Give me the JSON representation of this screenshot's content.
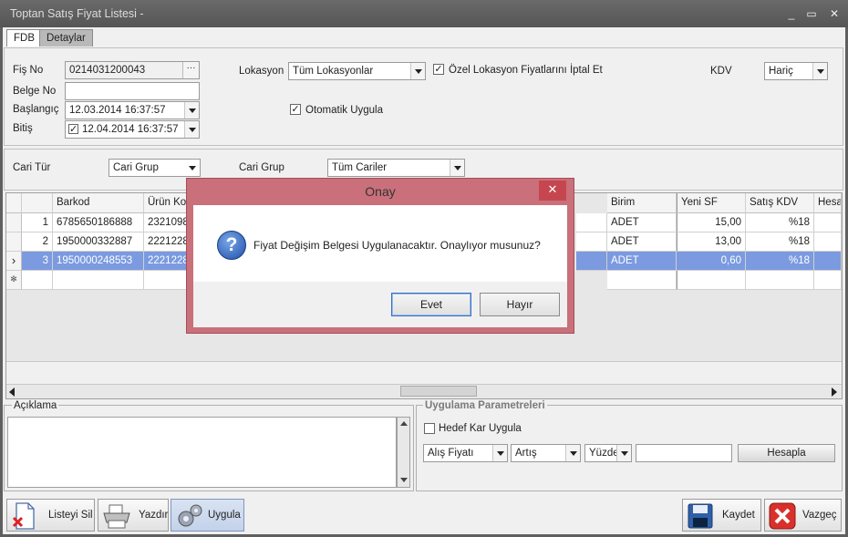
{
  "window": {
    "title": "Toptan Satış Fiyat Listesi -",
    "minimize": "_",
    "restore": "▭",
    "close": "✕"
  },
  "tabs": [
    {
      "label": "FDB"
    },
    {
      "label": "Detaylar"
    }
  ],
  "header": {
    "fis_no_label": "Fiş No",
    "fis_no_value": "0214031200043",
    "fis_no_btn": "···",
    "belge_no_label": "Belge No",
    "belge_no_value": "",
    "baslangic_label": "Başlangıç",
    "baslangic_value": "12.03.2014 16:37:57",
    "bitis_label": "Bitiş",
    "bitis_value": "12.04.2014 16:37:57",
    "bitis_checked": "✓",
    "lokasyon_label": "Lokasyon",
    "lokasyon_value": "Tüm Lokasyonlar",
    "ozel_lokasyon_label": "Özel Lokasyon Fiyatlarını İptal Et",
    "ozel_lokasyon_checked": "✓",
    "otomatik_label": "Otomatik Uygula",
    "otomatik_checked": "✓",
    "kdv_label": "KDV",
    "kdv_value": "Hariç"
  },
  "filter": {
    "cari_tur_label": "Cari Tür",
    "cari_tur_value": "Cari Grup",
    "cari_grup_label": "Cari Grup",
    "cari_grup_value": "Tüm Cariler"
  },
  "grid": {
    "columns": {
      "barkod": "Barkod",
      "urun_kod": "Ürün Kod",
      "birim": "Birim",
      "yeni_sf": "Yeni SF",
      "satis_kdv": "Satış KDV",
      "hesa": "Hesa"
    },
    "rows": [
      {
        "no": "1",
        "barkod": "6785650186888",
        "urun_kod": "2321098",
        "birim": "ADET",
        "yeni_sf": "15,00",
        "satis_kdv": "%18"
      },
      {
        "no": "2",
        "barkod": "1950000332887",
        "urun_kod": "2221228",
        "birim": "ADET",
        "yeni_sf": "13,00",
        "satis_kdv": "%18"
      },
      {
        "no": "3",
        "barkod": "1950000248553",
        "urun_kod": "2221228",
        "birim": "ADET",
        "yeni_sf": "0,60",
        "satis_kdv": "%18"
      }
    ],
    "current_row_marker": "›",
    "new_row_marker": "✻"
  },
  "aciklama": {
    "label": "Açıklama",
    "value": ""
  },
  "params": {
    "title": "Uygulama Parametreleri",
    "hedef_kar_label": "Hedef Kar Uygula",
    "alis_fiyati": "Alış Fiyatı",
    "artis": "Artış",
    "yuzde": "Yüzde",
    "amount": "",
    "hesapla": "Hesapla"
  },
  "buttons": {
    "listeyi_sil": "Listeyi Sil",
    "yazdir": "Yazdır",
    "uygula": "Uygula",
    "kaydet": "Kaydet",
    "vazgec": "Vazgeç"
  },
  "dialog": {
    "title": "Onay",
    "close": "✕",
    "message": "Fiyat Değişim Belgesi Uygulanacaktır. Onaylıyor musunuz?",
    "icon_glyph": "?",
    "yes": "Evet",
    "no": "Hayır"
  },
  "colors": {
    "selection": "#7b9ae0",
    "dialog_frame": "#c9707a",
    "dialog_close": "#c6464f",
    "titlebar": "#5f5f5f"
  }
}
